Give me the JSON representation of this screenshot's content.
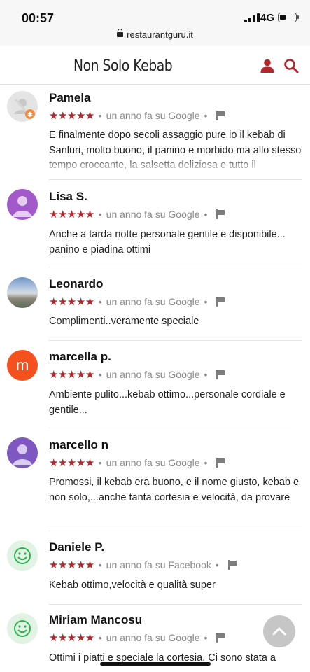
{
  "status_bar": {
    "time": "00:57",
    "network": "4G",
    "url": "restaurantguru.it"
  },
  "header": {
    "title": "Non Solo Kebab",
    "user_icon": "user-icon",
    "search_icon": "search-icon",
    "accent_color": "#b3262c"
  },
  "reviews": [
    {
      "name": "Pamela",
      "rating": 5,
      "stars": "★★★★★",
      "meta": "un anno fa su Google",
      "avatar": "default-avatar-icon",
      "text": "E finalmente dopo secoli assaggio pure io il kebab di Sanluri, molto buono, il panino e morbido ma allo stesso tempo croccante, la salsetta deliziosa e tutto il"
    },
    {
      "name": "Lisa S.",
      "rating": 5,
      "stars": "★★★★★",
      "meta": "un anno fa su Google",
      "avatar": "person-icon",
      "text": "Anche a tarda notte personale gentile e disponibile... panino e piadina ottimi"
    },
    {
      "name": "Leonardo",
      "rating": 5,
      "stars": "★★★★★",
      "meta": "un anno fa su Google",
      "avatar": "photo-avatar",
      "text": "Complimenti..veramente speciale"
    },
    {
      "name": "marcella p.",
      "rating": 5,
      "stars": "★★★★★",
      "meta": "un anno fa su Google",
      "avatar": "letter-avatar",
      "avatar_letter": "m",
      "text": "Ambiente pulito...kebab ottimo...personale cordiale e gentile..."
    },
    {
      "name": "marcello n",
      "rating": 5,
      "stars": "★★★★★",
      "meta": "un anno fa su Google",
      "avatar": "person-icon",
      "text": "Promossi, il kebab era buono, e il nome giusto, kebab e non solo,...anche tanta cortesia e velocità, da provare"
    },
    {
      "name": "Daniele P.",
      "rating": 5,
      "stars": "★★★★★",
      "meta": "un anno fa su Facebook",
      "avatar": "smiley-icon",
      "text": "Kebab ottimo,velocità e qualità super"
    },
    {
      "name": "Miriam Mancosu",
      "rating": 5,
      "stars": "★★★★★",
      "meta": "un anno fa su Google",
      "avatar": "smiley-icon",
      "text": "Ottimi i piatti e speciale la cortesia. Ci sono stata a"
    }
  ],
  "scroll_top_icon": "chevron-up-icon"
}
